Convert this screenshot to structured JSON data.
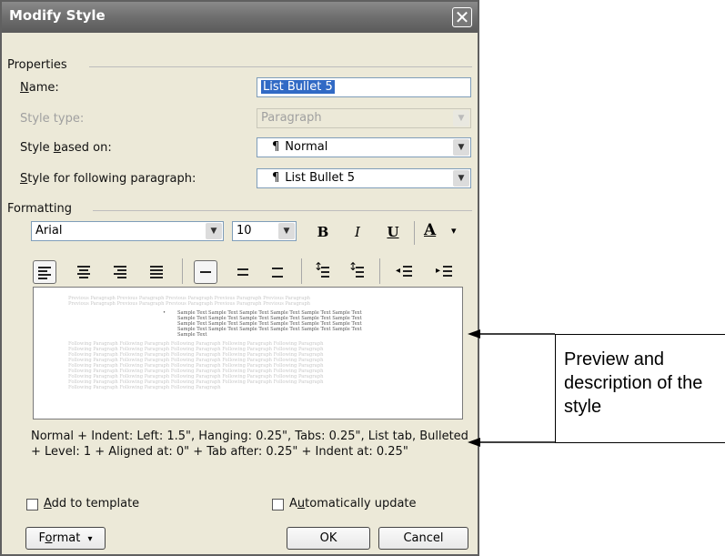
{
  "dialog": {
    "title": "Modify Style",
    "close_symbol": "✕"
  },
  "properties": {
    "section_label": "Properties",
    "name_label_ak": "N",
    "name_label_rest": "ame:",
    "name_value": "List Bullet 5",
    "style_type_label": "Style type:",
    "style_type_value": "Paragraph",
    "based_on_label_pre": "Style ",
    "based_on_label_ak": "b",
    "based_on_label_rest": "ased on:",
    "based_on_value": "Normal",
    "following_label_ak": "S",
    "following_label_rest": "tyle for following paragraph:",
    "following_value": "List Bullet 5",
    "para_mark": "¶"
  },
  "formatting": {
    "section_label": "Formatting",
    "font": "Arial",
    "size": "10",
    "bold": "B",
    "italic": "I",
    "underline": "U",
    "font_color": "A",
    "dropdown_caret": "▾"
  },
  "preview": {
    "previous_lines": [
      "Previous Paragraph Previous Paragraph Previous Paragraph Previous Paragraph Previous Paragraph",
      "Previous Paragraph Previous Paragraph Previous Paragraph Previous Paragraph Previous Paragraph"
    ],
    "bullet": "•",
    "sample_lines": [
      "Sample Text Sample Text Sample Text Sample Text Sample Text Sample Text",
      "Sample Text Sample Text Sample Text Sample Text Sample Text Sample Text",
      "Sample Text Sample Text Sample Text Sample Text Sample Text Sample Text",
      "Sample Text Sample Text Sample Text Sample Text Sample Text Sample Text",
      "Sample Text"
    ],
    "following_lines": [
      "Following Paragraph Following Paragraph Following Paragraph Following Paragraph Following Paragraph",
      "Following Paragraph Following Paragraph Following Paragraph Following Paragraph Following Paragraph",
      "Following Paragraph Following Paragraph Following Paragraph Following Paragraph Following Paragraph",
      "Following Paragraph Following Paragraph Following Paragraph Following Paragraph Following Paragraph",
      "Following Paragraph Following Paragraph Following Paragraph Following Paragraph Following Paragraph",
      "Following Paragraph Following Paragraph Following Paragraph Following Paragraph Following Paragraph",
      "Following Paragraph Following Paragraph Following Paragraph Following Paragraph Following Paragraph",
      "Following Paragraph Following Paragraph Following Paragraph Following Paragraph Following Paragraph",
      "Following Paragraph Following Paragraph Following Paragraph"
    ]
  },
  "description": "Normal + Indent: Left:  1.5\", Hanging:  0.25\", Tabs:  0.25\", List tab, Bulleted + Level: 1 + Aligned at:  0\" + Tab after:  0.25\" + Indent at:  0.25\"",
  "options": {
    "add_template_ak": "A",
    "add_template_rest": "dd to template",
    "auto_update_pre": "A",
    "auto_update_ak": "u",
    "auto_update_rest": "tomatically update"
  },
  "buttons": {
    "format_pre": "F",
    "format_ak": "o",
    "format_rest": "rmat",
    "format_caret": "▾",
    "ok": "OK",
    "cancel": "Cancel"
  },
  "callout": {
    "text": "Preview and description of the style"
  },
  "colors": {
    "dialog_bg": "#ece9d8",
    "titlebar": "#6e6e6e",
    "selection": "#316ac5"
  }
}
